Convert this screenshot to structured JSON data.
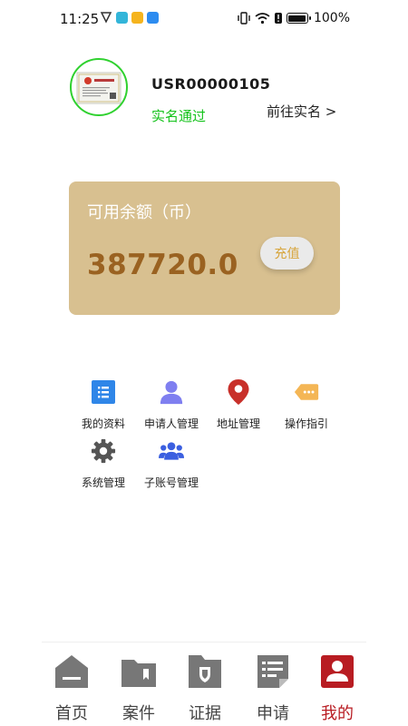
{
  "status_bar": {
    "time": "11:25",
    "battery": "100%",
    "battery_level": 1.0
  },
  "profile": {
    "user_id": "USR00000105",
    "verify_status": "实名通过",
    "verify_link": "前往实名 >",
    "avatar_icon": "business-license-icon"
  },
  "balance": {
    "label": "可用余额（币）",
    "amount": "387720.0",
    "recharge_label": "充值"
  },
  "menu": {
    "my_profile": "我的资料",
    "applicant_mgmt": "申请人管理",
    "address_mgmt": "地址管理",
    "guide": "操作指引",
    "system_mgmt": "系统管理",
    "sub_account_mgmt": "子账号管理"
  },
  "tabs": {
    "home": "首页",
    "cases": "案件",
    "evidence": "证据",
    "apply": "申请",
    "mine": "我的"
  },
  "colors": {
    "accent_red": "#b81c22",
    "card_bg": "#d8c090",
    "amount": "#9a6221",
    "verified_green": "#13c21a"
  }
}
